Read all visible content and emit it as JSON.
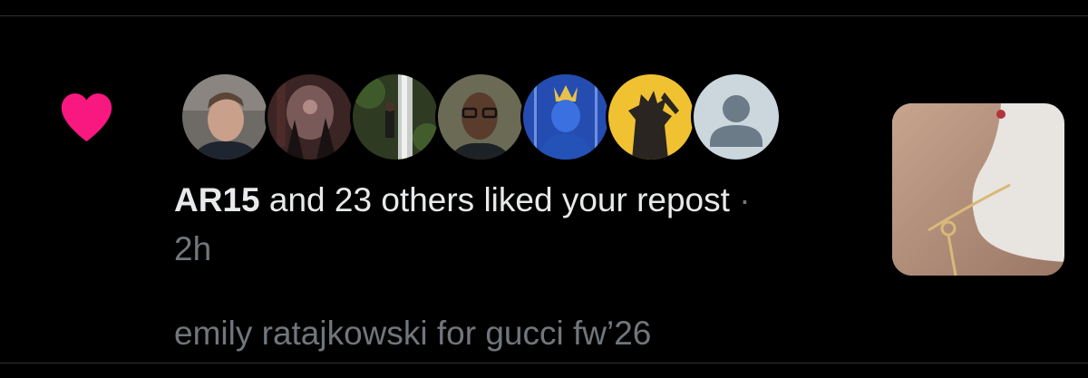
{
  "notification": {
    "icon": "heart-icon",
    "accent_color": "#f91880",
    "avatars": [
      {
        "icon": "avatar-photo-man"
      },
      {
        "icon": "avatar-photo-dark-art"
      },
      {
        "icon": "avatar-photo-waterfall"
      },
      {
        "icon": "avatar-photo-man-glasses"
      },
      {
        "icon": "avatar-photo-blue-statue"
      },
      {
        "icon": "avatar-photo-yellow-king"
      },
      {
        "icon": "default-avatar-icon"
      }
    ],
    "user": "AR15",
    "action_text": " and 23 others liked your repost",
    "separator": " · ",
    "time": "2h",
    "post_text": "emily ratajkowski for gucci fw’26",
    "thumbnail": {
      "icon": "post-image-thumbnail"
    }
  },
  "colors": {
    "background": "#000000",
    "primary_text": "#e7e9ea",
    "secondary_text": "#71767b",
    "divider": "#2f3336"
  }
}
